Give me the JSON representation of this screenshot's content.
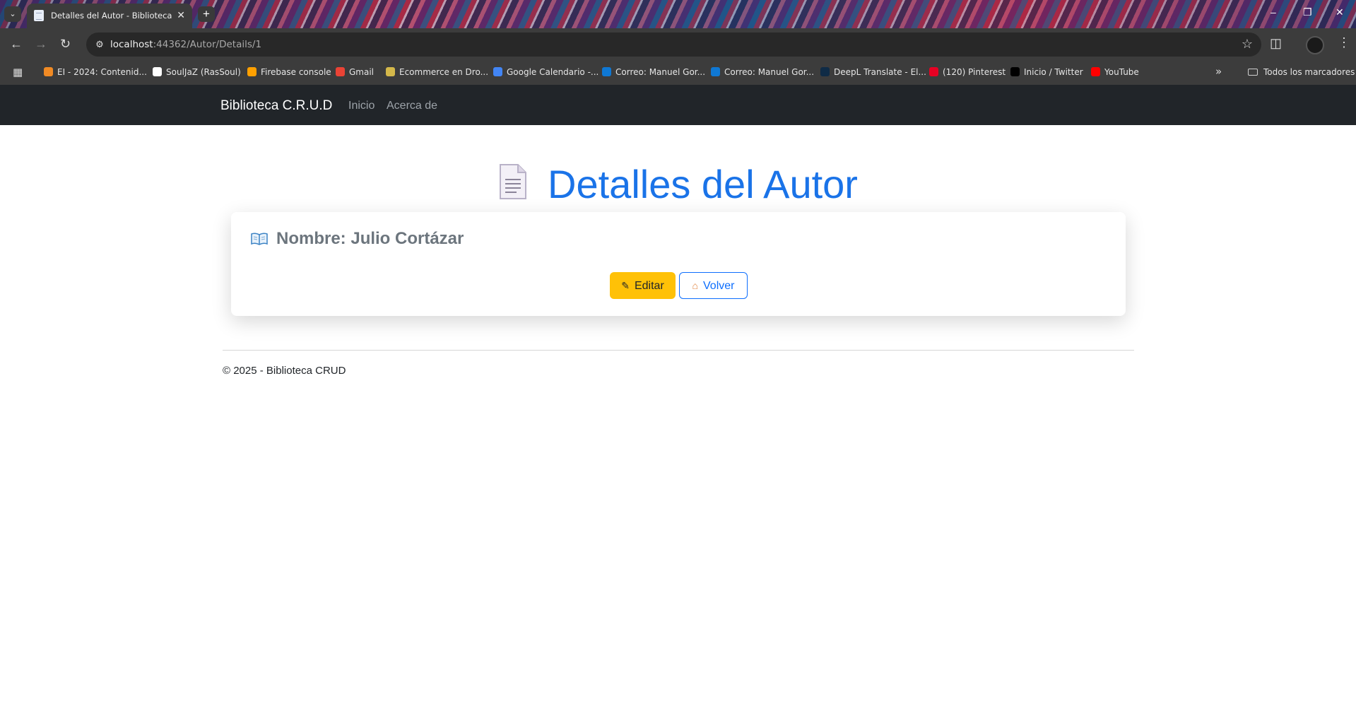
{
  "browser": {
    "tab_title": "Detalles del Autor - Biblioteca",
    "url_host": "localhost",
    "url_rest": ":44362/Autor/Details/1",
    "bookmarks": [
      {
        "label": "EI - 2024: Contenid...",
        "color": "#f08a24"
      },
      {
        "label": "SoulJaZ (RasSoul)",
        "color": "#ffffff"
      },
      {
        "label": "Firebase console",
        "color": "#ffa000"
      },
      {
        "label": "Gmail",
        "color": "#ea4335"
      },
      {
        "label": "Ecommerce en Dro...",
        "color": "#d4b84a"
      },
      {
        "label": "Google Calendario -...",
        "color": "#4285f4"
      },
      {
        "label": "Correo: Manuel Gor...",
        "color": "#0f78d4"
      },
      {
        "label": "Correo: Manuel Gor...",
        "color": "#0f78d4"
      },
      {
        "label": "DeepL Translate - El...",
        "color": "#0f2b46"
      },
      {
        "label": "(120) Pinterest",
        "color": "#e60023"
      },
      {
        "label": "Inicio / Twitter",
        "color": "#000000"
      },
      {
        "label": "YouTube",
        "color": "#ff0000"
      }
    ],
    "bookmarks_folder": "Todos los marcadores"
  },
  "navbar": {
    "brand": "Biblioteca C.R.U.D",
    "links": [
      "Inicio",
      "Acerca de"
    ]
  },
  "page": {
    "title": "Detalles del Autor",
    "name_line": "Nombre: Julio Cortázar",
    "edit_label": "Editar",
    "back_label": "Volver",
    "footer": "© 2025 - Biblioteca CRUD"
  },
  "colors": {
    "accent": "#1a73e8",
    "warning": "#ffc107",
    "primary": "#0d6efd",
    "navbar": "#212529"
  }
}
